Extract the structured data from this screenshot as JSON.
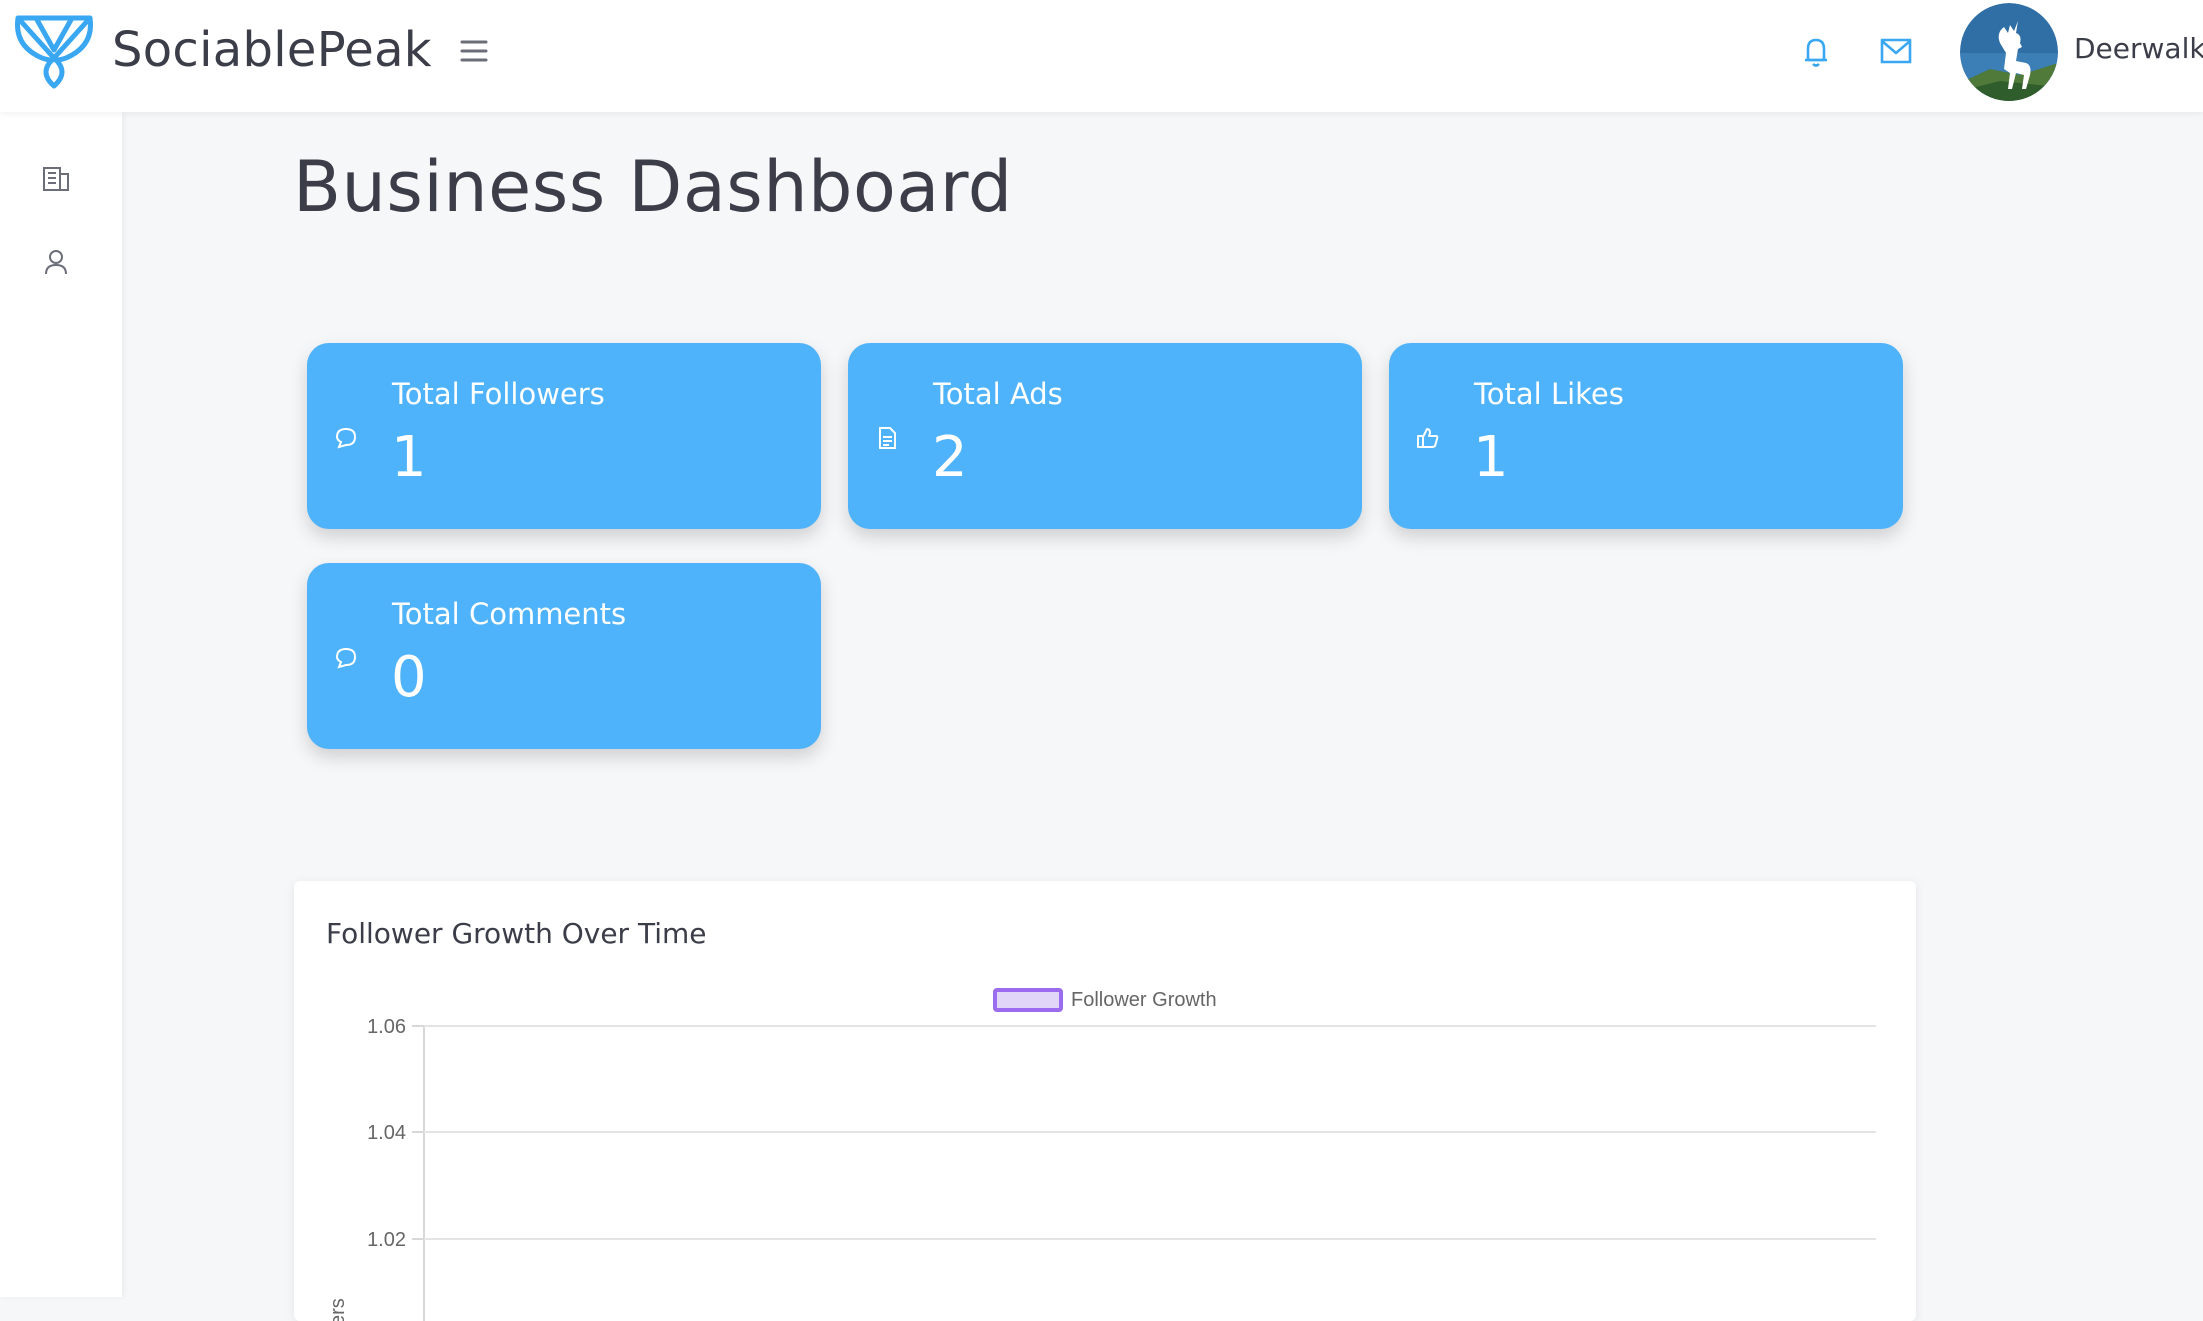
{
  "header": {
    "brand": "SociablePeak",
    "user_name": "Deerwalk"
  },
  "icons": {
    "logo": "brand-logo",
    "menu": "hamburger-icon",
    "notifications": "bell-icon",
    "messages": "mail-icon",
    "sidebar": [
      "building-icon",
      "user-icon"
    ]
  },
  "main": {
    "title": "Business Dashboard",
    "cards": [
      {
        "label": "Total Followers",
        "value": "1",
        "icon": "chat-bubble-icon"
      },
      {
        "label": "Total Ads",
        "value": "2",
        "icon": "document-icon"
      },
      {
        "label": "Total Likes",
        "value": "1",
        "icon": "thumbs-up-icon"
      },
      {
        "label": "Total Comments",
        "value": "0",
        "icon": "chat-bubble-icon"
      }
    ]
  },
  "colors": {
    "accent": "#4fb3fb",
    "icon_blue": "#3aa7f2",
    "legend_purple": "#9b6cf0"
  },
  "chart_data": {
    "type": "line",
    "title": "Follower Growth Over Time",
    "ylabel": "Followers",
    "ytick_labels": [
      "1.06",
      "1.04",
      "1.02"
    ],
    "series": [
      {
        "name": "Follower Growth",
        "values": []
      }
    ],
    "legend": "top-center",
    "grid": true
  }
}
